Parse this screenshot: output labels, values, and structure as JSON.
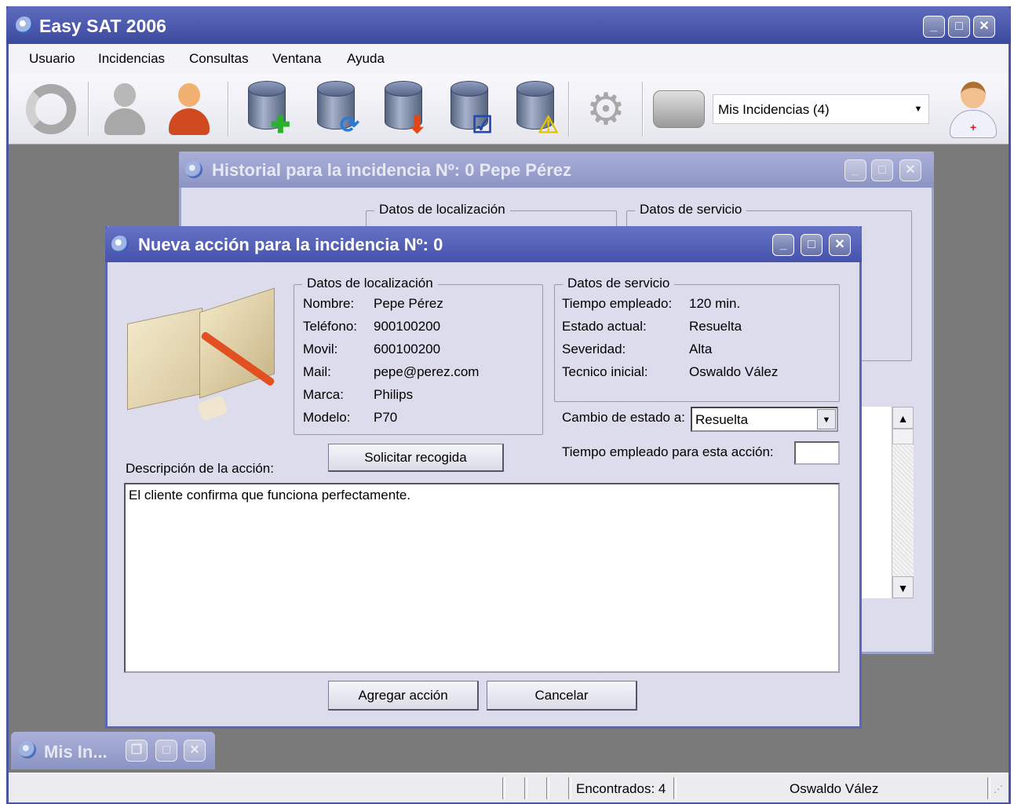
{
  "app": {
    "title": "Easy SAT 2006",
    "menu": [
      "Usuario",
      "Incidencias",
      "Consultas",
      "Ventana",
      "Ayuda"
    ],
    "toolbar": {
      "icons": [
        "refresh-icon",
        "user-gray-icon",
        "user-orange-icon",
        "database-add-icon",
        "database-sync-icon",
        "database-download-icon",
        "database-check-icon",
        "database-warning-icon",
        "gears-icon",
        "fax-icon",
        "doctor-icon"
      ],
      "combo_value": "Mis Incidencias (4)"
    }
  },
  "history_window": {
    "title": "Historial para la incidencia Nº: 0 Pepe Pérez",
    "group_localizacion": "Datos de localización",
    "group_servicio": "Datos de servicio"
  },
  "dialog": {
    "title": "Nueva acción para la incidencia Nº: 0",
    "group_localizacion": "Datos de localización",
    "localizacion": [
      {
        "label": "Nombre:",
        "value": "Pepe Pérez"
      },
      {
        "label": "Teléfono:",
        "value": "900100200"
      },
      {
        "label": "Movil:",
        "value": "600100200"
      },
      {
        "label": "Mail:",
        "value": "pepe@perez.com"
      },
      {
        "label": "Marca:",
        "value": "Philips"
      },
      {
        "label": "Modelo:",
        "value": "P70"
      }
    ],
    "group_servicio": "Datos de servicio",
    "servicio": [
      {
        "label": "Tiempo empleado:",
        "value": "120 min."
      },
      {
        "label": "Estado actual:",
        "value": "Resuelta"
      },
      {
        "label": "Severidad:",
        "value": "Alta"
      },
      {
        "label": "Tecnico inicial:",
        "value": "Oswaldo Vález"
      }
    ],
    "cambio_label": "Cambio de estado a:",
    "cambio_value": "Resuelta",
    "tiempo_label": "Tiempo empleado para esta acción:",
    "tiempo_value": "",
    "solicitar_button": "Solicitar recogida",
    "descripcion_label": "Descripción de la acción:",
    "descripcion_text": "El cliente confirma que funciona perfectamente.",
    "agregar_button": "Agregar acción",
    "cancelar_button": "Cancelar"
  },
  "minimized": {
    "title": "Mis In..."
  },
  "status": {
    "encontrados": "Encontrados: 4",
    "user": "Oswaldo Vález"
  }
}
